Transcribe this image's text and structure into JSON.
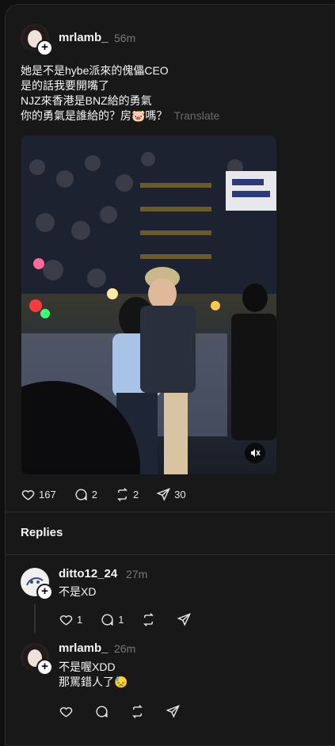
{
  "post": {
    "username": "mrlamb_",
    "time": "56m",
    "lines": [
      "她是不是hybe派來的傀儡CEO",
      "是的話我要開嘴了",
      "NJZ來香港是BNZ給的勇氣",
      "你的勇氣是誰給的？房🐷嗎？"
    ],
    "translate": "Translate",
    "stats": {
      "likes": "167",
      "comments": "2",
      "reposts": "2",
      "shares": "30"
    }
  },
  "replies_title": "Replies",
  "replies": [
    {
      "username": "ditto12_24",
      "time": "27m",
      "lines": [
        "不是XD"
      ],
      "stats": {
        "likes": "1",
        "comments": "1"
      }
    },
    {
      "username": "mrlamb_",
      "time": "26m",
      "lines": [
        "不是喔XDD",
        "那罵錯人了😓"
      ]
    }
  ],
  "icons": {
    "heart": "heart-icon",
    "comment": "comment-icon",
    "repost": "repost-icon",
    "share": "share-icon",
    "mute": "mute-icon",
    "plus": "plus-icon"
  },
  "colors": {
    "background": "#101010",
    "card": "#181818",
    "muted": "#777777"
  }
}
